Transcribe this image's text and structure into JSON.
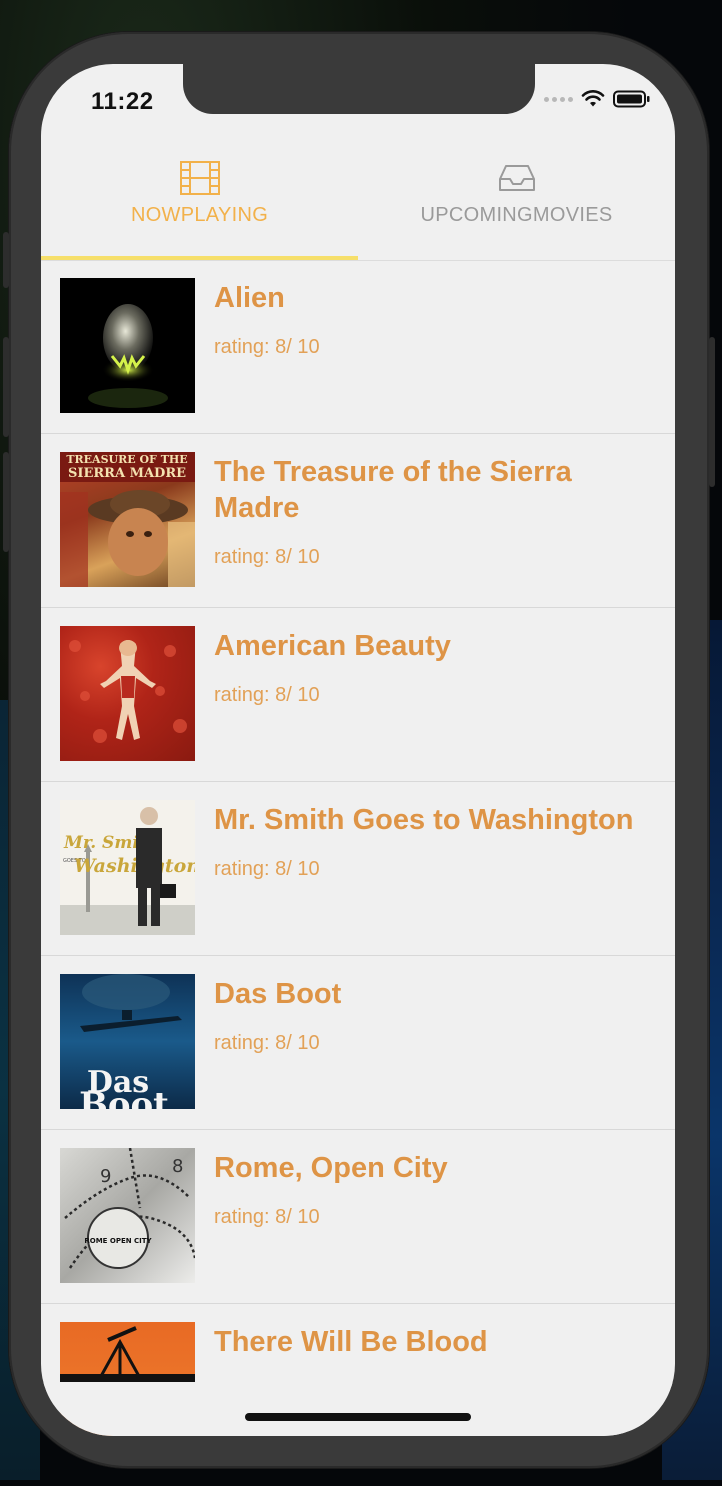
{
  "status_bar": {
    "time": "11:22"
  },
  "tabs": [
    {
      "label": "NOWPLAYING",
      "icon": "film-icon",
      "active": true
    },
    {
      "label": "UPCOMINGMOVIES",
      "icon": "inbox-icon",
      "active": false
    }
  ],
  "colors": {
    "accent": "#f2b14a",
    "title": "#de9446",
    "indicator": "#f6df6a"
  },
  "movies": [
    {
      "title": "Alien",
      "rating": "rating: 8/ 10"
    },
    {
      "title": "The Treasure of the Sierra Madre",
      "rating": "rating: 8/ 10",
      "poster_text": [
        "TREASURE OF THE",
        "SIERRA MADRE"
      ]
    },
    {
      "title": "American Beauty",
      "rating": "rating: 8/ 10"
    },
    {
      "title": "Mr. Smith Goes to Washington",
      "rating": "rating: 8/ 10",
      "poster_text": [
        "Mr. Smith",
        "GOES TO",
        "Washington"
      ]
    },
    {
      "title": "Das Boot",
      "rating": "rating: 8/ 10",
      "poster_text": [
        "Das",
        "Boot"
      ]
    },
    {
      "title": "Rome, Open City",
      "rating": "rating: 8/ 10",
      "poster_text": [
        "9",
        "8",
        "ROME OPEN CITY"
      ]
    },
    {
      "title": "There Will Be Blood"
    }
  ]
}
